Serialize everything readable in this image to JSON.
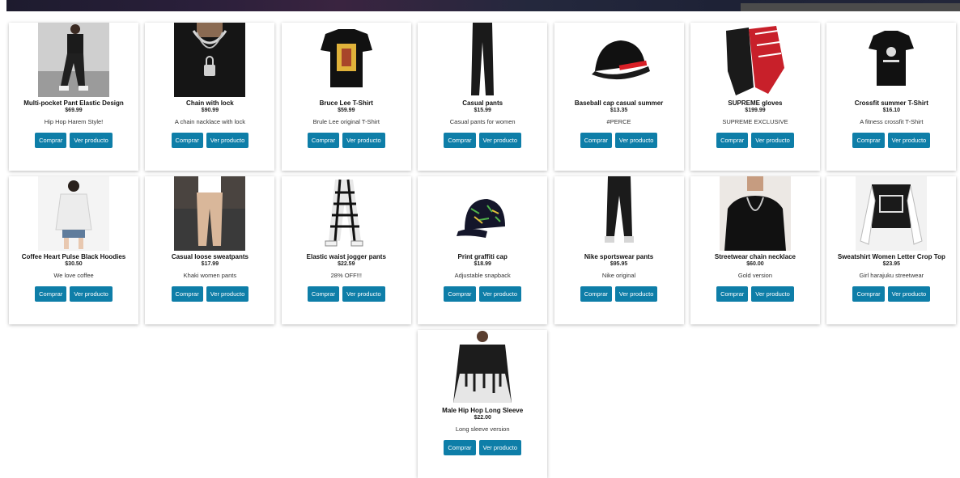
{
  "buttons": {
    "buy": "Comprar",
    "view": "Ver producto"
  },
  "colors": {
    "button": "#0e7ea8",
    "card_bg": "#ffffff"
  },
  "products": [
    {
      "title": "Multi-pocket Pant Elastic Design",
      "price": "$69.99",
      "desc": "Hip Hop Harem Style!",
      "image": "black-cargo-pants-photo"
    },
    {
      "title": "Chain with lock",
      "price": "$90.99",
      "desc": "A chain nacklace with lock",
      "image": "chain-lock-necklace-photo"
    },
    {
      "title": "Bruce Lee T-Shirt",
      "price": "$59.99",
      "desc": "Brule Lee original T-Shirt",
      "image": "bruce-lee-tshirt-photo"
    },
    {
      "title": "Casual pants",
      "price": "$15.99",
      "desc": "Casual pants for women",
      "image": "casual-pants-photo"
    },
    {
      "title": "Baseball cap casual summer",
      "price": "$13.35",
      "desc": "#PERCE",
      "image": "baseball-cap-photo"
    },
    {
      "title": "SUPREME gloves",
      "price": "$199.99",
      "desc": "SUPREME EXCLUSIVE",
      "image": "supreme-gloves-photo"
    },
    {
      "title": "Crossfit summer T-Shirt",
      "price": "$16.10",
      "desc": "A fitness crossfit T-Shirt",
      "image": "crossfit-tshirt-photo"
    },
    {
      "title": "Coffee Heart Pulse Black Hoodies",
      "price": "$30.50",
      "desc": "We love coffee",
      "image": "white-hoodie-photo"
    },
    {
      "title": "Casual loose sweatpants",
      "price": "$17.99",
      "desc": "Khaki women pants",
      "image": "khaki-sweatpants-photo"
    },
    {
      "title": "Elastic waist jogger pants",
      "price": "$22.59",
      "desc": "28% OFF!!!",
      "image": "plaid-jogger-photo"
    },
    {
      "title": "Print graffiti cap",
      "price": "$18.99",
      "desc": "Adjustable snapback",
      "image": "graffiti-cap-photo"
    },
    {
      "title": "Nike sportswear pants",
      "price": "$95.95",
      "desc": "Nike original",
      "image": "nike-pants-photo"
    },
    {
      "title": "Streetwear chain necklace",
      "price": "$60.00",
      "desc": "Gold version",
      "image": "chain-necklace-photo"
    },
    {
      "title": "Sweatshirt Women Letter Crop Top",
      "price": "$23.95",
      "desc": "Girl harajuku streetwear",
      "image": "girl-crop-top-photo"
    },
    {
      "title": "Male Hip Hop Long Sleeve",
      "price": "$22.00",
      "desc": "Long sleeve version",
      "image": "long-sleeve-photo"
    }
  ]
}
